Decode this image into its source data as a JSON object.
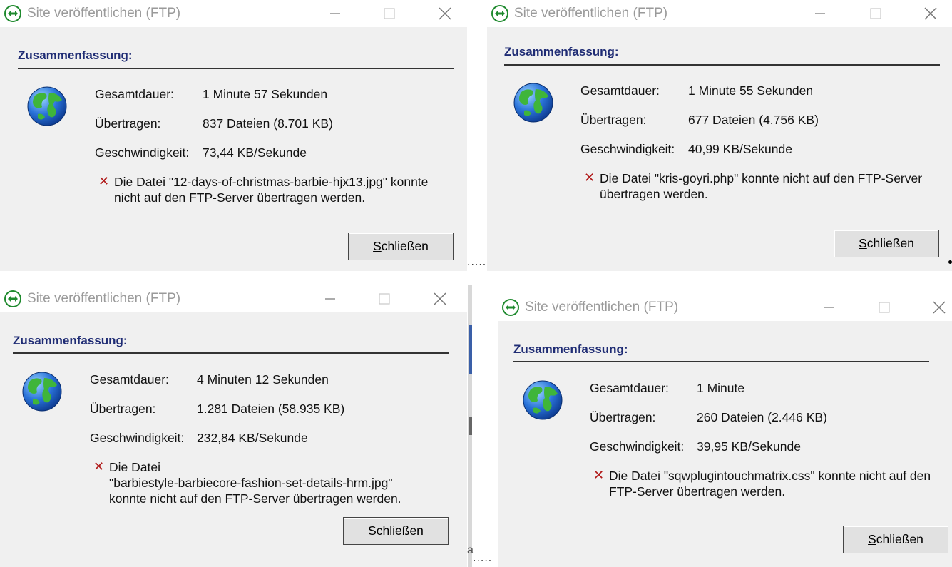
{
  "colors": {
    "dialog_bg": "#f0f0f0",
    "title_text": "#9a9a9a",
    "heading": "#1f2c74",
    "error_x": "#b01818",
    "button_bg": "#e1e1e1"
  },
  "icons": {
    "title": "transfer-arrows-icon",
    "summary": "globe-icon",
    "error": "error-x-icon",
    "minimize": "minimize-icon",
    "maximize": "maximize-icon",
    "close": "close-icon"
  },
  "dialogs": [
    {
      "title": "Site veröffentlichen (FTP)",
      "summary_heading": "Zusammenfassung:",
      "duration_label": "Gesamtdauer:",
      "duration_value": "1 Minute 57 Sekunden",
      "transferred_label": "Übertragen:",
      "transferred_value": "837 Dateien (8.701 KB)",
      "speed_label": "Geschwindigkeit:",
      "speed_value": "73,44 KB/Sekunde",
      "error_lines": [
        "Die Datei \"12-days-of-christmas-barbie-hjx13.jpg\" konnte",
        "nicht auf den FTP-Server übertragen werden."
      ],
      "close_button_mnemonic": "S",
      "close_button_rest": "chließen"
    },
    {
      "title": "Site veröffentlichen (FTP)",
      "summary_heading": "Zusammenfassung:",
      "duration_label": "Gesamtdauer:",
      "duration_value": "1 Minute 55 Sekunden",
      "transferred_label": "Übertragen:",
      "transferred_value": "677 Dateien (4.756 KB)",
      "speed_label": "Geschwindigkeit:",
      "speed_value": "40,99 KB/Sekunde",
      "error_lines": [
        "Die Datei \"kris-goyri.php\" konnte nicht auf den FTP-Server",
        "übertragen werden."
      ],
      "close_button_mnemonic": "S",
      "close_button_rest": "chließen"
    },
    {
      "title": "Site veröffentlichen (FTP)",
      "summary_heading": "Zusammenfassung:",
      "duration_label": "Gesamtdauer:",
      "duration_value": "4 Minuten 12 Sekunden",
      "transferred_label": "Übertragen:",
      "transferred_value": "1.281 Dateien (58.935 KB)",
      "speed_label": "Geschwindigkeit:",
      "speed_value": "232,84 KB/Sekunde",
      "error_lines": [
        "Die Datei",
        "\"barbiestyle-barbiecore-fashion-set-details-hrm.jpg\"",
        "konnte nicht auf den FTP-Server übertragen werden."
      ],
      "close_button_mnemonic": "S",
      "close_button_rest": "chließen"
    },
    {
      "title": "Site veröffentlichen (FTP)",
      "summary_heading": "Zusammenfassung:",
      "duration_label": "Gesamtdauer:",
      "duration_value": "1 Minute",
      "transferred_label": "Übertragen:",
      "transferred_value": "260 Dateien (2.446 KB)",
      "speed_label": "Geschwindigkeit:",
      "speed_value": "39,95 KB/Sekunde",
      "error_lines": [
        "Die Datei \"sqwplugintouchmatrix.css\" konnte nicht auf den",
        "FTP-Server übertragen werden."
      ],
      "close_button_mnemonic": "S",
      "close_button_rest": "chließen"
    }
  ],
  "separators": {
    "dots": ".....",
    "edge_letter": "a"
  }
}
